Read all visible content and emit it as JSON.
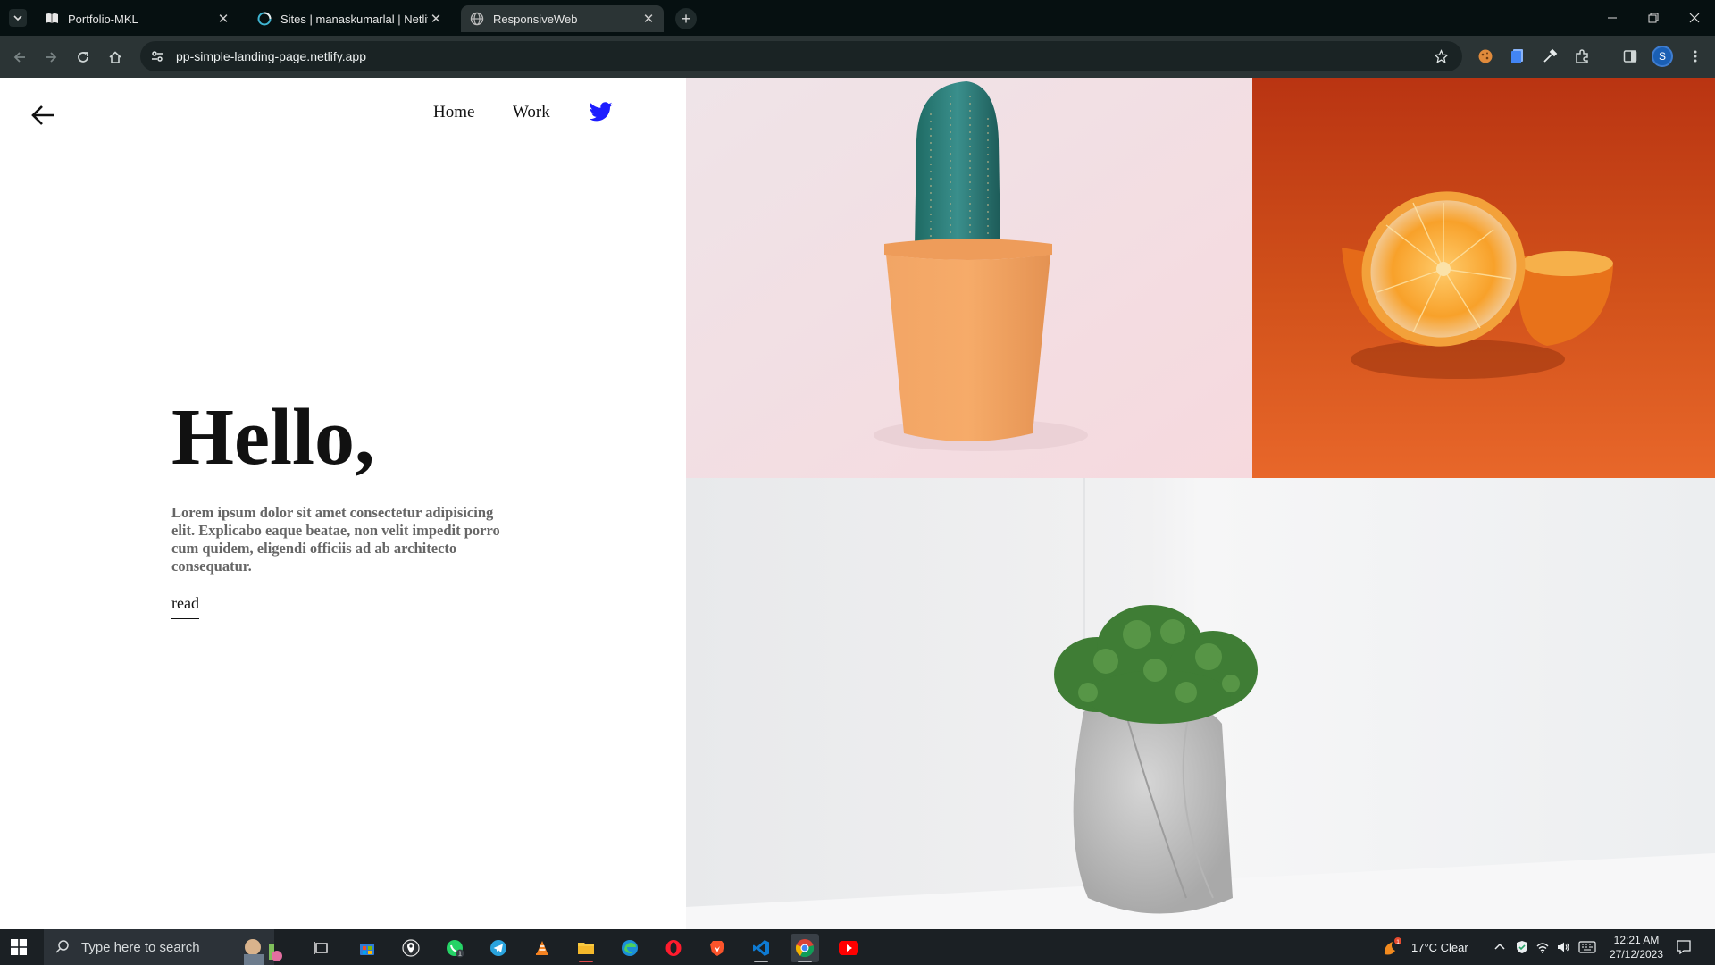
{
  "browser": {
    "tabs": [
      {
        "title": "Portfolio-MKL",
        "icon": "book-favicon",
        "active": false
      },
      {
        "title": "Sites | manaskumarlal | Netlify",
        "icon": "netlify-favicon",
        "active": false
      },
      {
        "title": "ResponsiveWeb",
        "icon": "globe-favicon",
        "active": true
      }
    ],
    "url": "pp-simple-landing-page.netlify.app",
    "profile_initial": "S",
    "accent": "#1a5fb4"
  },
  "page": {
    "nav": {
      "home_label": "Home",
      "work_label": "Work",
      "twitter_icon": "twitter-icon",
      "twitter_color": "#1d1dff"
    },
    "hero": {
      "heading": "Hello,",
      "body": "Lorem ipsum dolor sit amet consectetur adipisicing elit. Explicabo eaque beatae, non velit impedit porro cum quidem, eligendi officiis ad ab architecto consequatur.",
      "link_label": "read"
    },
    "images": [
      {
        "name": "cactus-in-terracotta-pot",
        "background": "#f3e6e9"
      },
      {
        "name": "halved-orange",
        "background": "#d2521b"
      },
      {
        "name": "moss-in-concrete-pot",
        "background": "#ebecee"
      }
    ]
  },
  "taskbar": {
    "search_placeholder": "Type here to search",
    "weather": "17°C  Clear",
    "time": "12:21 AM",
    "date": "27/12/2023"
  }
}
